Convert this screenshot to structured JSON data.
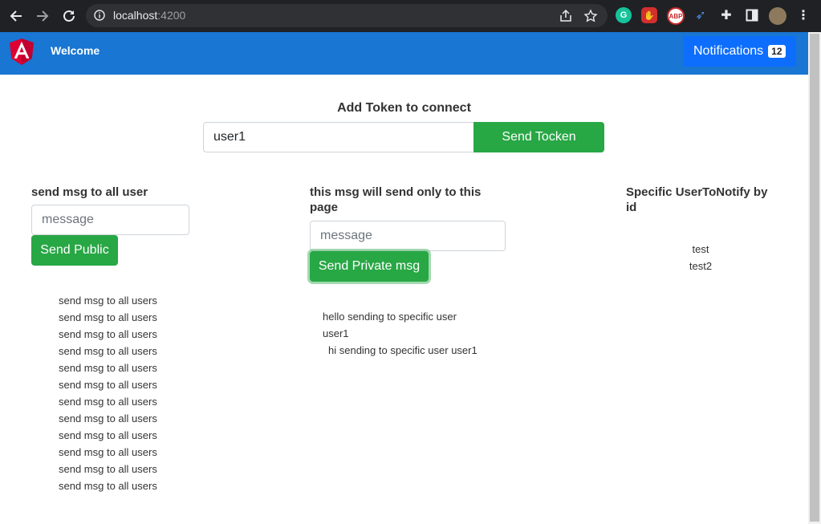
{
  "browser": {
    "url_host": "localhost",
    "url_port": ":4200"
  },
  "navbar": {
    "brand": "Welcome",
    "notifications_label": "Notifications",
    "notifications_count": "12",
    "color": "#1976d2"
  },
  "token": {
    "title": "Add Token to connect",
    "input_value": "user1",
    "button_label": "Send Tocken"
  },
  "public": {
    "title": "send msg to all user",
    "placeholder": "message",
    "button_label": "Send Public",
    "messages": [
      "send msg to all users",
      "send msg to all users",
      "send msg to all users",
      "send msg to all users",
      "send msg to all users",
      "send msg to all users",
      "send msg to all users",
      "send msg to all users",
      "send msg to all users",
      "send msg to all users",
      "send msg to all users",
      "send msg to all users"
    ]
  },
  "private": {
    "title_line1": "this msg will send only to this",
    "title_line2": "page",
    "placeholder": "message",
    "button_label": "Send Private msg",
    "messages": [
      "hello sending to specific user",
      "user1",
      "hi sending to specific user user1"
    ]
  },
  "specific": {
    "title_line1": "Specific UserToNotify by",
    "title_line2": "id",
    "items": [
      "test",
      "test2"
    ]
  }
}
